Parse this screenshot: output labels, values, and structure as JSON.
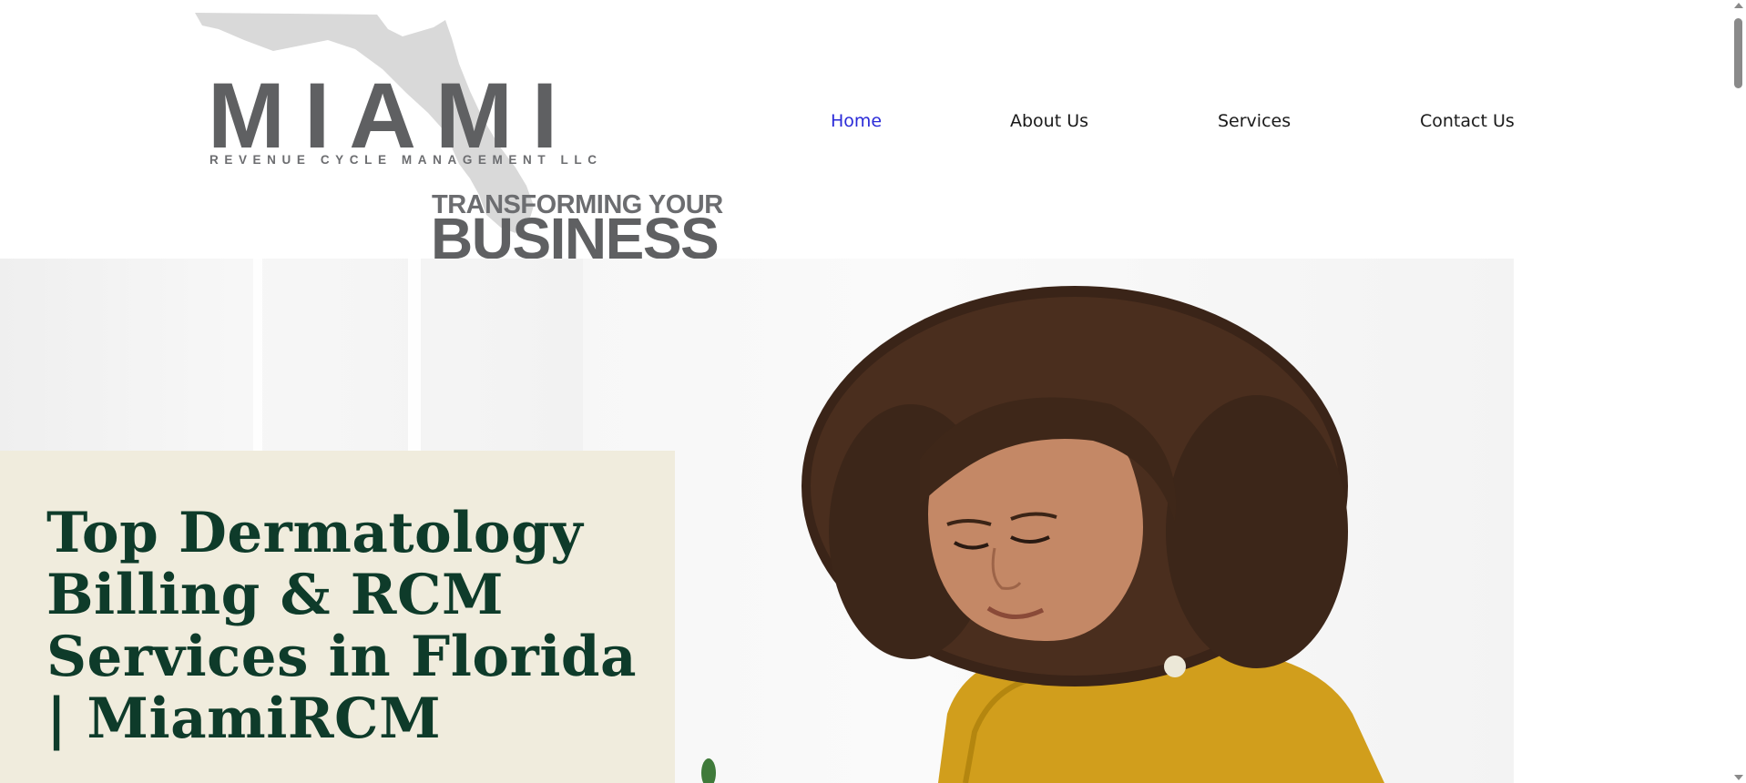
{
  "logo": {
    "name": "MIAMI",
    "subtitle": "REVENUE CYCLE MANAGEMENT LLC",
    "tagline_top": "TRANSFORMING YOUR",
    "tagline_bottom": "BUSINESS"
  },
  "nav": {
    "items": [
      {
        "label": "Home",
        "active": true
      },
      {
        "label": "About Us",
        "active": false
      },
      {
        "label": "Services",
        "active": false
      },
      {
        "label": "Contact Us",
        "active": false
      }
    ]
  },
  "hero": {
    "title": "Top Dermatology Billing & RCM Services in Florida | MiamiRCM"
  },
  "colors": {
    "nav_active": "#2a2ad8",
    "nav_text": "#1a1a1a",
    "hero_card_bg": "#f0ecdd",
    "hero_title": "#0e3b2a",
    "logo_gray": "#5f6062",
    "florida_shape": "#d9d9d9"
  },
  "icons": {
    "logo_shape": "florida-map-icon",
    "scroll_up": "chevron-up-icon",
    "scroll_down": "chevron-down-icon"
  }
}
